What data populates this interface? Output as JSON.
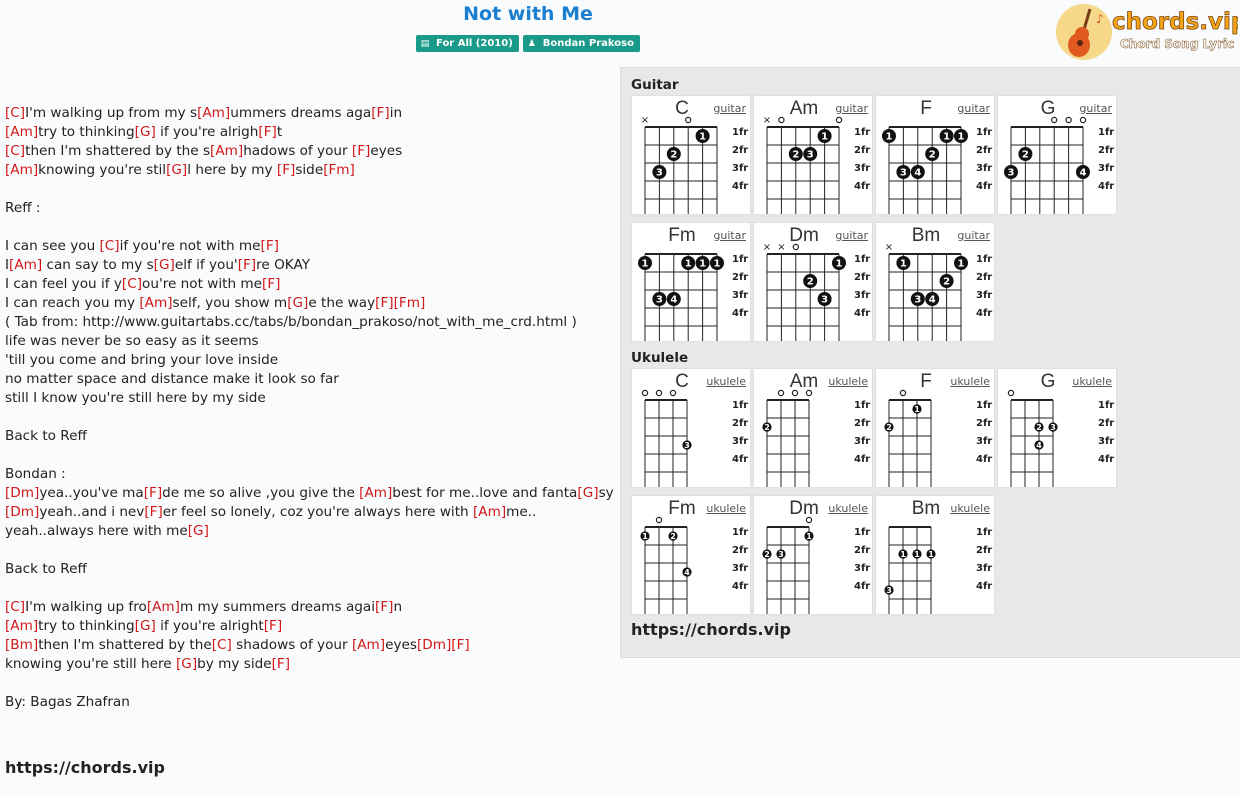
{
  "song": {
    "title": "Not with Me",
    "album_badge": "For All (2010)",
    "artist_badge": "Bondan Prakoso"
  },
  "logo": {
    "brand": "chords.vip",
    "tagline": "Chord Song Lyric"
  },
  "lyrics": [
    [
      {
        "c": "C"
      },
      {
        "t": "I'm walking up from my s"
      },
      {
        "c": "Am"
      },
      {
        "t": "ummers dreams aga"
      },
      {
        "c": "F"
      },
      {
        "t": "in"
      }
    ],
    [
      {
        "c": "Am"
      },
      {
        "t": "try to thinking"
      },
      {
        "c": "G"
      },
      {
        "t": " if you're alrigh"
      },
      {
        "c": "F"
      },
      {
        "t": "t"
      }
    ],
    [
      {
        "c": "C"
      },
      {
        "t": "then I'm shattered by the s"
      },
      {
        "c": "Am"
      },
      {
        "t": "hadows of your "
      },
      {
        "c": "F"
      },
      {
        "t": "eyes"
      }
    ],
    [
      {
        "c": "Am"
      },
      {
        "t": "knowing you're stil"
      },
      {
        "c": "G"
      },
      {
        "t": "l here by my "
      },
      {
        "c": "F"
      },
      {
        "t": "side"
      },
      {
        "c": "Fm"
      }
    ],
    [],
    [
      {
        "t": "Reff :"
      }
    ],
    [],
    [
      {
        "t": "I can see you "
      },
      {
        "c": "C"
      },
      {
        "t": "if you're not with me"
      },
      {
        "c": "F"
      }
    ],
    [
      {
        "t": "I"
      },
      {
        "c": "Am"
      },
      {
        "t": " can say to my s"
      },
      {
        "c": "G"
      },
      {
        "t": "elf if you'"
      },
      {
        "c": "F"
      },
      {
        "t": "re OKAY"
      }
    ],
    [
      {
        "t": "I can feel you if y"
      },
      {
        "c": "C"
      },
      {
        "t": "ou're not with me"
      },
      {
        "c": "F"
      }
    ],
    [
      {
        "t": "I can reach you my "
      },
      {
        "c": "Am"
      },
      {
        "t": "self, you show m"
      },
      {
        "c": "G"
      },
      {
        "t": "e the way"
      },
      {
        "c": "F"
      },
      {
        "c": "Fm"
      }
    ],
    [
      {
        "t": "( Tab from: http://www.guitartabs.cc/tabs/b/bondan_prakoso/not_with_me_crd.html )"
      }
    ],
    [
      {
        "t": "life was never be so easy as it seems"
      }
    ],
    [
      {
        "t": "'till you come and bring your love inside"
      }
    ],
    [
      {
        "t": "no matter space and distance make it look so far"
      }
    ],
    [
      {
        "t": "still I know you're still here by my side"
      }
    ],
    [],
    [
      {
        "t": "Back to Reff"
      }
    ],
    [],
    [
      {
        "t": "Bondan :"
      }
    ],
    [
      {
        "c": "Dm"
      },
      {
        "t": "yea..you've ma"
      },
      {
        "c": "F"
      },
      {
        "t": "de me so alive ,you give the "
      },
      {
        "c": "Am"
      },
      {
        "t": "best for me..love and fanta"
      },
      {
        "c": "G"
      },
      {
        "t": "sy"
      }
    ],
    [
      {
        "c": "Dm"
      },
      {
        "t": "yeah..and i nev"
      },
      {
        "c": "F"
      },
      {
        "t": "er feel so lonely, coz you're always here with "
      },
      {
        "c": "Am"
      },
      {
        "t": "me.."
      }
    ],
    [
      {
        "t": "yeah..always here with me"
      },
      {
        "c": "G"
      }
    ],
    [],
    [
      {
        "t": "Back to Reff"
      }
    ],
    [],
    [
      {
        "c": "C"
      },
      {
        "t": "I'm walking up fro"
      },
      {
        "c": "Am"
      },
      {
        "t": "m my summers dreams agai"
      },
      {
        "c": "F"
      },
      {
        "t": "n"
      }
    ],
    [
      {
        "c": "Am"
      },
      {
        "t": "try to thinking"
      },
      {
        "c": "G"
      },
      {
        "t": " if you're alright"
      },
      {
        "c": "F"
      }
    ],
    [
      {
        "c": "Bm"
      },
      {
        "t": "then I'm shattered by the"
      },
      {
        "c": "C"
      },
      {
        "t": " shadows of your "
      },
      {
        "c": "Am"
      },
      {
        "t": "eyes"
      },
      {
        "c": "Dm"
      },
      {
        "c": "F"
      }
    ],
    [
      {
        "t": "knowing you're still here "
      },
      {
        "c": "G"
      },
      {
        "t": "by my side"
      },
      {
        "c": "F"
      }
    ],
    [],
    [
      {
        "t": "By: Bagas Zhafran"
      }
    ]
  ],
  "site_link": "https://chords.vip",
  "panel": {
    "guitar_title": "Guitar",
    "ukulele_title": "Ukulele",
    "site_link": "https://chords.vip",
    "fret_labels": [
      "1fr",
      "2fr",
      "3fr",
      "4fr"
    ],
    "guitar_label": "guitar",
    "ukulele_label": "ukulele"
  },
  "guitar_chords": [
    {
      "name": "C",
      "marks": [
        "x",
        "",
        "",
        "o",
        "",
        ""
      ],
      "dots": [
        [
          5,
          1,
          "1"
        ],
        [
          3,
          2,
          "2"
        ],
        [
          2,
          3,
          "3"
        ]
      ]
    },
    {
      "name": "Am",
      "marks": [
        "x",
        "o",
        "",
        "",
        "",
        "o"
      ],
      "dots": [
        [
          5,
          1,
          "1"
        ],
        [
          3,
          2,
          "2"
        ],
        [
          4,
          2,
          "3"
        ]
      ]
    },
    {
      "name": "F",
      "marks": [
        "",
        "",
        "",
        "",
        "",
        ""
      ],
      "dots": [
        [
          1,
          1,
          "1"
        ],
        [
          5,
          1,
          "1"
        ],
        [
          6,
          1,
          "1"
        ],
        [
          4,
          2,
          "2"
        ],
        [
          2,
          3,
          "3"
        ],
        [
          3,
          3,
          "4"
        ]
      ]
    },
    {
      "name": "G",
      "marks": [
        "",
        "",
        "",
        "o",
        "o",
        "o"
      ],
      "dots": [
        [
          2,
          2,
          "2"
        ],
        [
          1,
          3,
          "3"
        ],
        [
          6,
          3,
          "4"
        ]
      ]
    },
    {
      "name": "Fm",
      "marks": [
        "",
        "",
        "",
        "",
        "",
        ""
      ],
      "dots": [
        [
          1,
          1,
          "1"
        ],
        [
          4,
          1,
          "1"
        ],
        [
          5,
          1,
          "1"
        ],
        [
          6,
          1,
          "1"
        ],
        [
          2,
          3,
          "3"
        ],
        [
          3,
          3,
          "4"
        ]
      ]
    },
    {
      "name": "Dm",
      "marks": [
        "x",
        "x",
        "o",
        "",
        "",
        ""
      ],
      "dots": [
        [
          6,
          1,
          "1"
        ],
        [
          4,
          2,
          "2"
        ],
        [
          5,
          3,
          "3"
        ]
      ]
    },
    {
      "name": "Bm",
      "marks": [
        "x",
        "",
        "",
        "",
        "",
        ""
      ],
      "dots": [
        [
          2,
          1,
          "1"
        ],
        [
          6,
          1,
          "1"
        ],
        [
          5,
          2,
          "2"
        ],
        [
          3,
          3,
          "3"
        ],
        [
          4,
          3,
          "4"
        ]
      ]
    }
  ],
  "ukulele_chords": [
    {
      "name": "C",
      "marks": [
        "o",
        "o",
        "o",
        ""
      ],
      "dots": [
        [
          4,
          3,
          "3"
        ]
      ]
    },
    {
      "name": "Am",
      "marks": [
        "",
        "o",
        "o",
        "o"
      ],
      "dots": [
        [
          1,
          2,
          "2"
        ]
      ]
    },
    {
      "name": "F",
      "marks": [
        "",
        "o",
        "",
        ""
      ],
      "dots": [
        [
          3,
          1,
          "1"
        ],
        [
          1,
          2,
          "2"
        ]
      ]
    },
    {
      "name": "G",
      "marks": [
        "o",
        "",
        "",
        ""
      ],
      "dots": [
        [
          3,
          2,
          "2"
        ],
        [
          4,
          2,
          "3"
        ],
        [
          3,
          3,
          "4"
        ]
      ]
    },
    {
      "name": "Fm",
      "marks": [
        "",
        "o",
        "",
        ""
      ],
      "dots": [
        [
          1,
          1,
          "1"
        ],
        [
          3,
          1,
          "2"
        ],
        [
          4,
          3,
          "4"
        ]
      ]
    },
    {
      "name": "Dm",
      "marks": [
        "",
        "",
        "",
        "o"
      ],
      "dots": [
        [
          4,
          1,
          "1"
        ],
        [
          1,
          2,
          "2"
        ],
        [
          2,
          2,
          "3"
        ]
      ]
    },
    {
      "name": "Bm",
      "marks": [
        "",
        "",
        "",
        ""
      ],
      "dots": [
        [
          2,
          2,
          "1"
        ],
        [
          3,
          2,
          "1"
        ],
        [
          4,
          2,
          "1"
        ],
        [
          1,
          4,
          "3"
        ]
      ]
    }
  ],
  "colors": {
    "title": "#1a7fd0",
    "badge": "#1a9b8a",
    "chord": "#d21818",
    "logo_orange": "#f5a31a"
  }
}
